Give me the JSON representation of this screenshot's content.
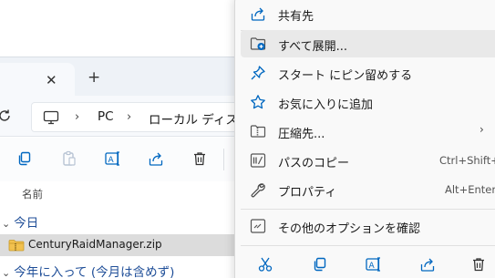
{
  "explorer": {
    "tab_close_glyph": "✕",
    "new_tab_glyph": "+",
    "address": {
      "separators": [
        "›",
        "›"
      ],
      "crumbs": [
        "PC",
        "ローカル ディスク ("
      ]
    },
    "file_list": {
      "column_name_header": "名前",
      "groups": [
        {
          "label": "今日",
          "chevron": "⌄"
        },
        {
          "label": "今年に入って (今月は含めず)",
          "chevron": "⌄"
        }
      ],
      "files": [
        {
          "name": "CenturyRaidManager.zip",
          "selected": true
        }
      ]
    }
  },
  "context_menu": {
    "items": [
      {
        "label": "共有先",
        "icon": "share-icon",
        "shortcut": "",
        "submenu": false
      },
      {
        "label": "すべて展開...",
        "icon": "extract-all-icon",
        "shortcut": "",
        "submenu": false,
        "hover": true
      },
      {
        "label": "スタート にピン留めする",
        "icon": "pin-icon",
        "shortcut": "",
        "submenu": false
      },
      {
        "label": "お気に入りに追加",
        "icon": "star-icon",
        "shortcut": "",
        "submenu": false
      },
      {
        "label": "圧縮先...",
        "icon": "zip-folder-icon",
        "shortcut": "",
        "submenu": true
      },
      {
        "label": "パスのコピー",
        "icon": "copy-path-icon",
        "shortcut": "Ctrl+Shift+C",
        "submenu": false
      },
      {
        "label": "プロパティ",
        "icon": "wrench-icon",
        "shortcut": "Alt+Enter",
        "submenu": false
      },
      {
        "label": "その他のオプションを確認",
        "icon": "more-options-icon",
        "shortcut": "",
        "submenu": false
      }
    ],
    "submenu_arrow_glyph": "›",
    "bottom_actions": [
      "cut-icon",
      "copy-icon",
      "rename-icon",
      "share-icon",
      "delete-icon"
    ]
  },
  "colors": {
    "accent": "#0067c0",
    "group_header": "#1f4e98",
    "hover": "#e9e9e9",
    "selected_row": "#dcdcdc"
  }
}
